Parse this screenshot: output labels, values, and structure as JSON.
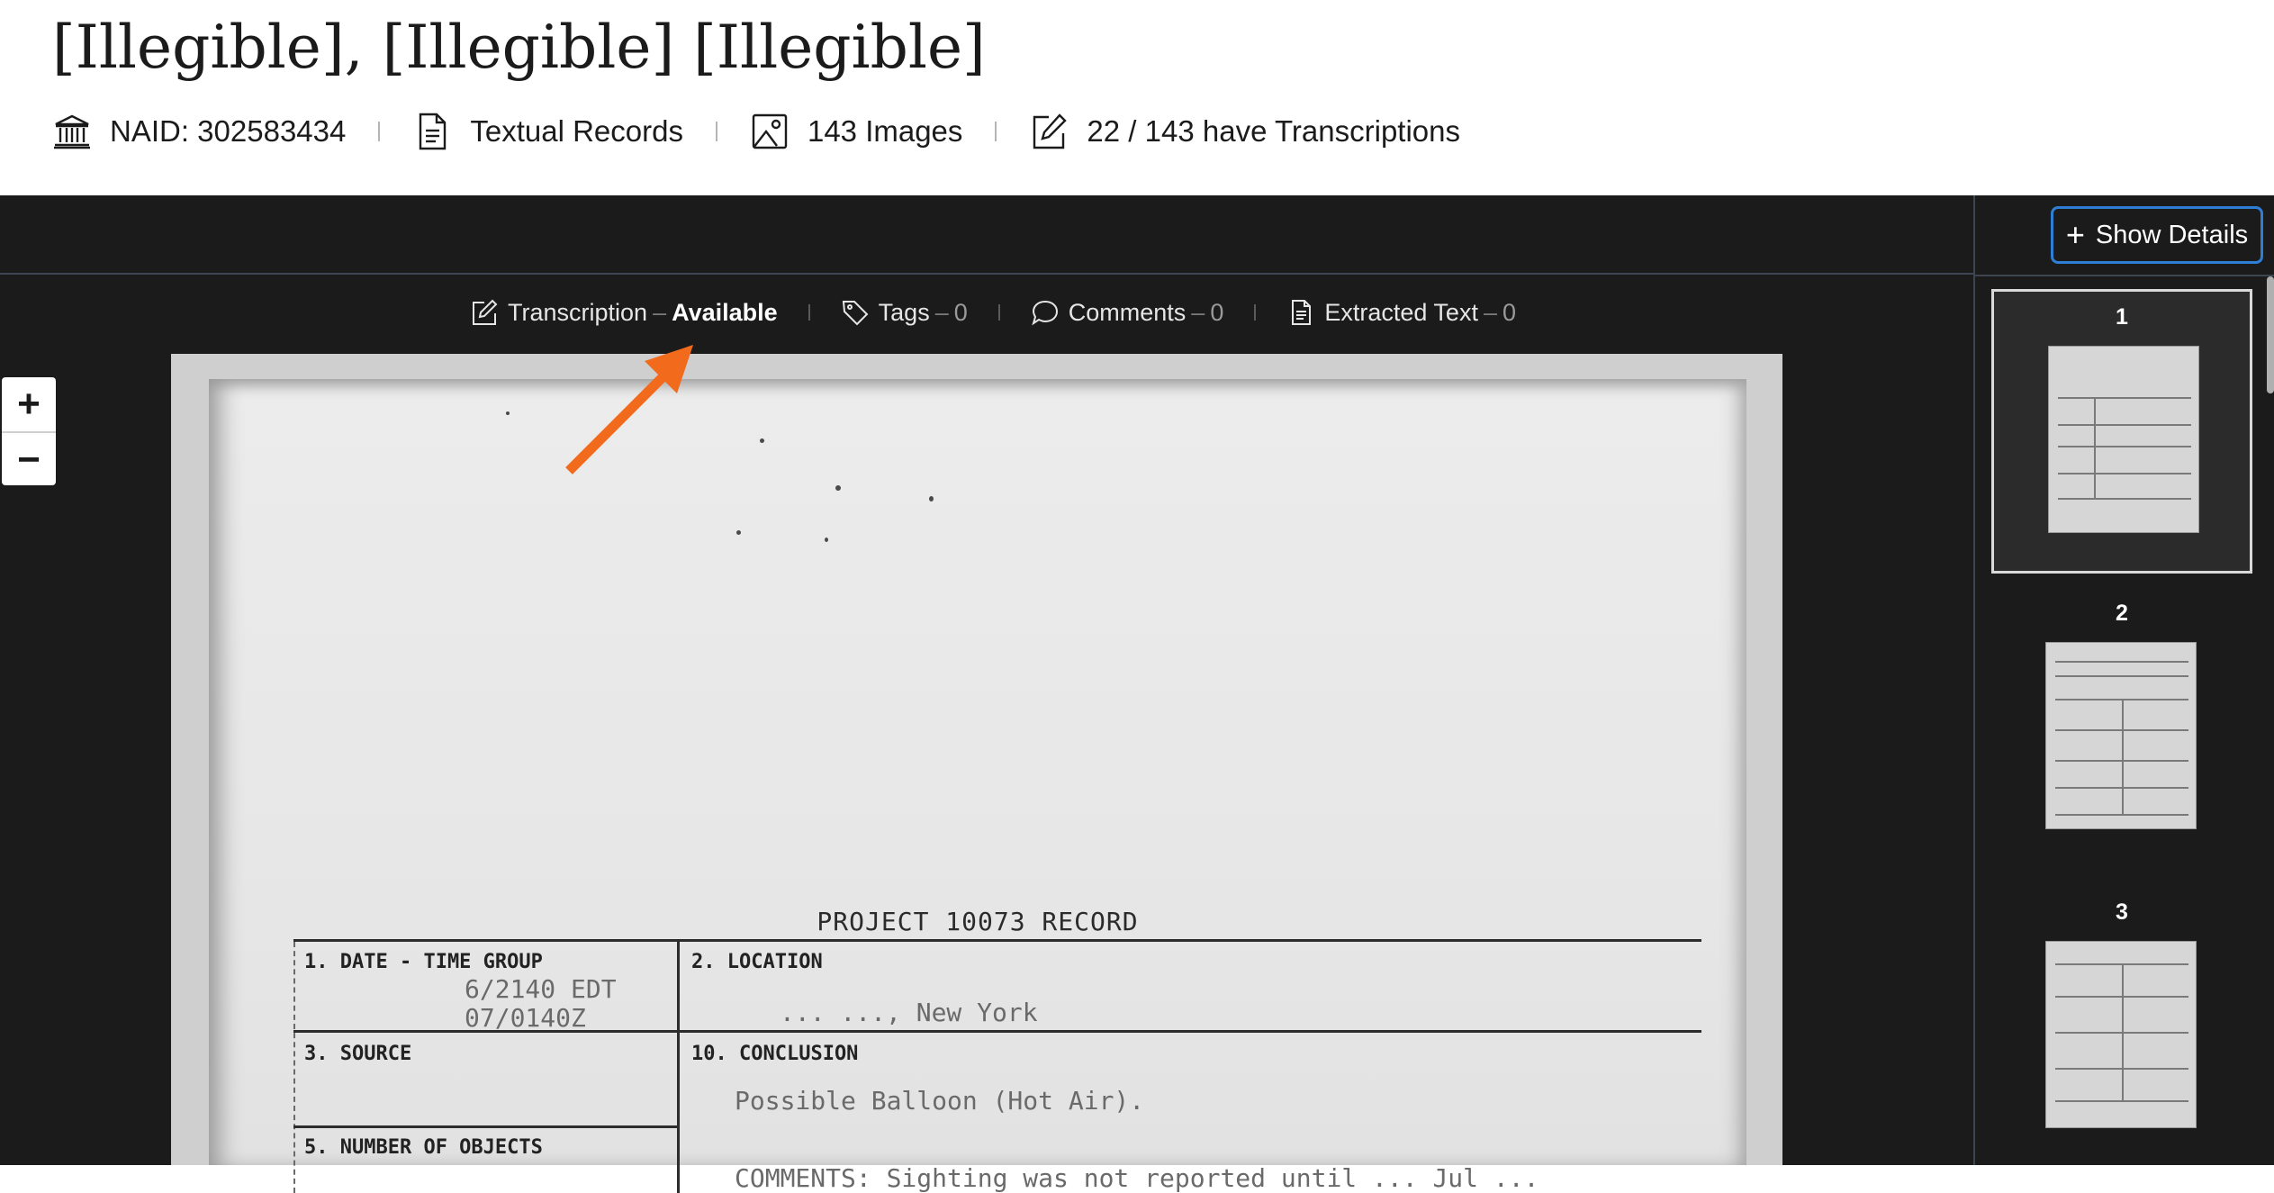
{
  "header": {
    "title": "[Illegible], [Illegible] [Illegible]",
    "meta": {
      "naid": "NAID: 302583434",
      "record_type": "Textual Records",
      "images": "143 Images",
      "transcriptions": "22 / 143 have Transcriptions"
    }
  },
  "viewer": {
    "show_details_label": "Show Details",
    "tabs": {
      "transcription": {
        "label": "Transcription",
        "status": "Available"
      },
      "tags": {
        "label": "Tags",
        "count": "0"
      },
      "comments": {
        "label": "Comments",
        "count": "0"
      },
      "extracted_text": {
        "label": "Extracted Text",
        "count": "0"
      }
    },
    "tab_dash": "–",
    "zoom": {
      "in": "+",
      "out": "−"
    },
    "document": {
      "heading": "PROJECT 10073 RECORD",
      "cells": {
        "date_time": "1. DATE - TIME GROUP",
        "date_value_1": "6/2140 EDT",
        "date_value_2": "07/0140Z",
        "location": "2. LOCATION",
        "location_value": "... ..., New York",
        "source": "3. SOURCE",
        "conclusion": "10. CONCLUSION",
        "conclusion_value": "Possible Balloon (Hot Air).",
        "objects": "5. NUMBER OF OBJECTS",
        "comments_value": "COMMENTS:  Sighting was not reported until ... Jul ..."
      }
    },
    "annotation_arrow_color": "#f26b1d",
    "accent_color": "#2e7ed6"
  },
  "thumbnails": [
    {
      "number": "1"
    },
    {
      "number": "2"
    },
    {
      "number": "3"
    }
  ]
}
